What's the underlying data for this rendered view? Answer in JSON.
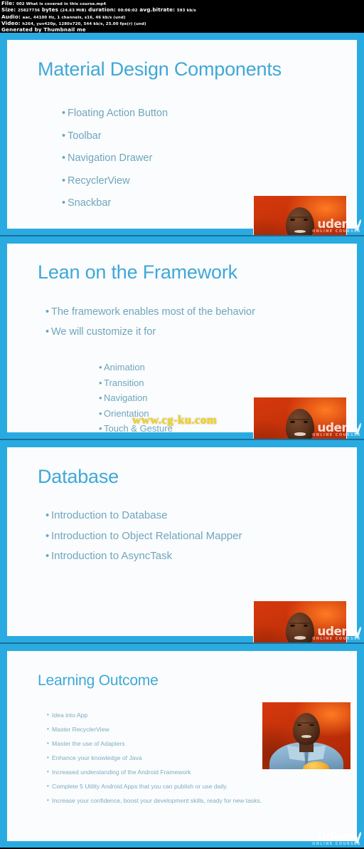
{
  "media_info": {
    "file_label": "File:",
    "file_name": "002 What is covered in this course.mp4",
    "size_label": "Size:",
    "size_bytes": "25827736",
    "size_unit": "bytes",
    "size_mib": "(24.63 MiB)",
    "duration_label": "duration:",
    "duration_value": "00:06:02",
    "bitrate_label": "avg.bitrate:",
    "bitrate_value": "593 kb/s",
    "audio_label": "Audio:",
    "audio_value": "aac, 44100 Hz, 1 channels, s16, 46 kb/s (und)",
    "video_label": "Video:",
    "video_value": "h264, yuv420p, 1280x720, 544 kb/s, 25.00 fps(r) (und)",
    "generator": "Generated by Thumbnail me"
  },
  "colors": {
    "frame": "#29ABE2",
    "seam": "#1B6F96",
    "slide_bg": "#FBFCFD",
    "title": "#3FA8D8",
    "bullet": "#6FA5BE",
    "bullet_small": "#7DADC2",
    "watermark_site": "#F2D21A",
    "pip_bg": "#C33009"
  },
  "watermarks": {
    "udemy_primary": "udemy",
    "udemy_secondary": "ONLINE COURSES",
    "site": "www.cg-ku.com"
  },
  "slides": [
    {
      "index": 1,
      "title": "Material Design Components",
      "bullets": [
        "Floating Action Button",
        "Toolbar",
        "Navigation Drawer",
        "RecyclerView",
        "Snackbar"
      ]
    },
    {
      "index": 2,
      "title": "Lean on the Framework",
      "bullets": [
        "The framework enables most of the behavior",
        "We will customize it for"
      ],
      "sub_bullets": [
        "Animation",
        "Transition",
        "Navigation",
        "Orientation",
        "Touch & Gesture"
      ]
    },
    {
      "index": 3,
      "title": "Database",
      "bullets": [
        "Introduction to Database",
        "Introduction to Object Relational Mapper",
        "Introduction to AsyncTask"
      ]
    },
    {
      "index": 4,
      "title": "Learning Outcome",
      "bullets": [
        "Idea into App",
        "Master RecyclerView",
        "Master the use of Adapters",
        "Enhance your knowledge of Java",
        "Increased understanding of the Android Framework",
        "Complete 5 Utility Android Apps that you can publish or use daily.",
        "Increase your confidence, boost your development skills, ready for new tasks."
      ]
    }
  ]
}
